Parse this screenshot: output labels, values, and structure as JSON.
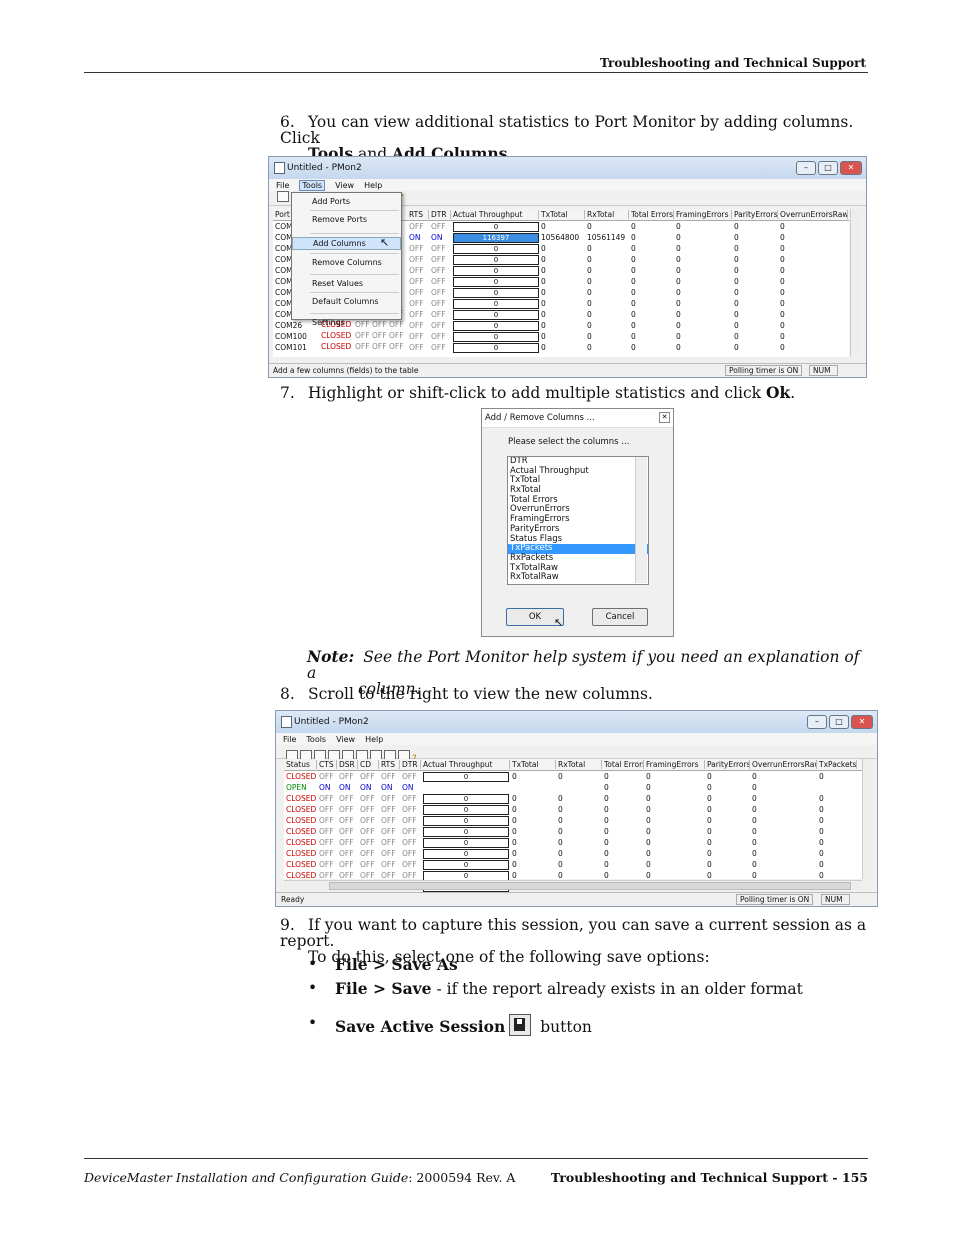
{
  "header": {
    "title": "Troubleshooting and Technical Support"
  },
  "steps": {
    "s6_num": "6.",
    "s6_line1": "You can view additional statistics to Port Monitor by adding columns. Click",
    "s6_tools": "Tools",
    "s6_and": " and ",
    "s6_addcols": "Add Columns",
    "s6_end": ".",
    "s7_num": "7.",
    "s7_text": "Highlight or shift-click to add multiple statistics and click ",
    "s7_ok": "Ok",
    "s7_end": ".",
    "note_label": "Note:",
    "note_line1": "See the Port Monitor help system if you need an explanation of a",
    "note_line2": "column.",
    "s8_num": "8.",
    "s8_text": "Scroll to the right to view the new columns.",
    "s9_num": "9.",
    "s9_line1": "If you want to capture this session, you can save a current session as a report.",
    "s9_line2": "To do this, select one of the following save options:",
    "bullet1": "File > Save As",
    "bullet2_bold": "File > Save",
    "bullet2_rest": " - if the report already exists in an older format",
    "bullet3_bold": "Save Active Session",
    "bullet3_rest": "button"
  },
  "shot1": {
    "title": "Untitled - PMon2",
    "menu": [
      "File",
      "Tools",
      "View",
      "Help"
    ],
    "popup_items": [
      "Add Ports",
      "Remove Ports",
      "Add Columns",
      "Remove Columns",
      "Reset Values",
      "Default Columns",
      "Settings"
    ],
    "columns": [
      "Port",
      "RTS",
      "DTR",
      "Actual Throughput",
      "TxTotal",
      "RxTotal",
      "Total Errors",
      "FramingErrors",
      "ParityErrors",
      "OverrunErrorsRaw"
    ],
    "rows": [
      {
        "port": "COM",
        "st": "",
        "rts": "OFF",
        "dtr": "OFF",
        "thr": "0",
        "tx": "0",
        "rx": "0",
        "te": "0",
        "fe": "0",
        "pe": "0",
        "oe": "0"
      },
      {
        "port": "COM",
        "st": "",
        "rts": "ON",
        "dtr": "ON",
        "thr": "116397",
        "tx": "10564800",
        "rx": "10561149",
        "te": "0",
        "fe": "0",
        "pe": "0",
        "oe": "0"
      },
      {
        "port": "COM",
        "st": "",
        "rts": "OFF",
        "dtr": "OFF",
        "thr": "0",
        "tx": "0",
        "rx": "0",
        "te": "0",
        "fe": "0",
        "pe": "0",
        "oe": "0"
      },
      {
        "port": "COM",
        "st": "",
        "rts": "OFF",
        "dtr": "OFF",
        "thr": "0",
        "tx": "0",
        "rx": "0",
        "te": "0",
        "fe": "0",
        "pe": "0",
        "oe": "0"
      },
      {
        "port": "COM",
        "st": "",
        "rts": "OFF",
        "dtr": "OFF",
        "thr": "0",
        "tx": "0",
        "rx": "0",
        "te": "0",
        "fe": "0",
        "pe": "0",
        "oe": "0"
      },
      {
        "port": "COM",
        "st": "",
        "rts": "OFF",
        "dtr": "OFF",
        "thr": "0",
        "tx": "0",
        "rx": "0",
        "te": "0",
        "fe": "0",
        "pe": "0",
        "oe": "0"
      },
      {
        "port": "COM",
        "st": "",
        "rts": "OFF",
        "dtr": "OFF",
        "thr": "0",
        "tx": "0",
        "rx": "0",
        "te": "0",
        "fe": "0",
        "pe": "0",
        "oe": "0"
      },
      {
        "port": "COM",
        "st": "",
        "rts": "OFF",
        "dtr": "OFF",
        "thr": "0",
        "tx": "0",
        "rx": "0",
        "te": "0",
        "fe": "0",
        "pe": "0",
        "oe": "0"
      },
      {
        "port": "COM25",
        "st": "CLOSED",
        "rts": "OFF",
        "dtr": "OFF",
        "thr": "0",
        "tx": "0",
        "rx": "0",
        "te": "0",
        "fe": "0",
        "pe": "0",
        "oe": "0"
      },
      {
        "port": "COM26",
        "st": "CLOSED",
        "rts": "OFF",
        "dtr": "OFF",
        "thr": "0",
        "tx": "0",
        "rx": "0",
        "te": "0",
        "fe": "0",
        "pe": "0",
        "oe": "0"
      },
      {
        "port": "COM100",
        "st": "CLOSED",
        "rts": "OFF",
        "dtr": "OFF",
        "thr": "0",
        "tx": "0",
        "rx": "0",
        "te": "0",
        "fe": "0",
        "pe": "0",
        "oe": "0"
      },
      {
        "port": "COM101",
        "st": "CLOSED",
        "rts": "OFF",
        "dtr": "OFF",
        "thr": "0",
        "tx": "0",
        "rx": "0",
        "te": "0",
        "fe": "0",
        "pe": "0",
        "oe": "0"
      }
    ],
    "mid_flags": "OFF",
    "status_left": "Add a few columns (fields) to the table",
    "status_timer": "Polling timer is ON",
    "status_num": "NUM"
  },
  "dialog": {
    "title": "Add / Remove Columns ...",
    "prompt": "Please select the columns ...",
    "items": [
      "DTR",
      "Actual Throughput",
      "TxTotal",
      "RxTotal",
      "Total Errors",
      "OverrunErrors",
      "FramingErrors",
      "ParityErrors",
      "Status Flags",
      "TxPackets",
      "RxPackets",
      "TxTotalRaw",
      "RxTotalRaw"
    ],
    "selected": "TxPackets",
    "ok": "OK",
    "cancel": "Cancel"
  },
  "shot2": {
    "title": "Untitled - PMon2",
    "menu": [
      "File",
      "Tools",
      "View",
      "Help"
    ],
    "columns": [
      "Status",
      "CTS",
      "DSR",
      "CD",
      "RTS",
      "DTR",
      "Actual Throughput",
      "TxTotal",
      "RxTotal",
      "Total Errors",
      "FramingErrors",
      "ParityErrors",
      "OverrunErrorsRaw",
      "TxPackets"
    ],
    "rows": [
      {
        "st": "CLOSED",
        "f": [
          "OFF",
          "OFF",
          "OFF",
          "OFF",
          "OFF"
        ],
        "thr": "0",
        "tx": "0",
        "rx": "0",
        "te": "0",
        "fe": "0",
        "pe": "0",
        "oe": "0",
        "tp": "0"
      },
      {
        "st": "OPEN",
        "f": [
          "ON",
          "ON",
          "ON",
          "ON",
          "ON"
        ],
        "thr": "",
        "tx": "",
        "rx": "",
        "te": "0",
        "fe": "0",
        "pe": "0",
        "oe": "0",
        "tp": ""
      },
      {
        "st": "CLOSED",
        "f": [
          "OFF",
          "OFF",
          "OFF",
          "OFF",
          "OFF"
        ],
        "thr": "0",
        "tx": "0",
        "rx": "0",
        "te": "0",
        "fe": "0",
        "pe": "0",
        "oe": "0",
        "tp": "0"
      },
      {
        "st": "CLOSED",
        "f": [
          "OFF",
          "OFF",
          "OFF",
          "OFF",
          "OFF"
        ],
        "thr": "0",
        "tx": "0",
        "rx": "0",
        "te": "0",
        "fe": "0",
        "pe": "0",
        "oe": "0",
        "tp": "0"
      },
      {
        "st": "CLOSED",
        "f": [
          "OFF",
          "OFF",
          "OFF",
          "OFF",
          "OFF"
        ],
        "thr": "0",
        "tx": "0",
        "rx": "0",
        "te": "0",
        "fe": "0",
        "pe": "0",
        "oe": "0",
        "tp": "0"
      },
      {
        "st": "CLOSED",
        "f": [
          "OFF",
          "OFF",
          "OFF",
          "OFF",
          "OFF"
        ],
        "thr": "0",
        "tx": "0",
        "rx": "0",
        "te": "0",
        "fe": "0",
        "pe": "0",
        "oe": "0",
        "tp": "0"
      },
      {
        "st": "CLOSED",
        "f": [
          "OFF",
          "OFF",
          "OFF",
          "OFF",
          "OFF"
        ],
        "thr": "0",
        "tx": "0",
        "rx": "0",
        "te": "0",
        "fe": "0",
        "pe": "0",
        "oe": "0",
        "tp": "0"
      },
      {
        "st": "CLOSED",
        "f": [
          "OFF",
          "OFF",
          "OFF",
          "OFF",
          "OFF"
        ],
        "thr": "0",
        "tx": "0",
        "rx": "0",
        "te": "0",
        "fe": "0",
        "pe": "0",
        "oe": "0",
        "tp": "0"
      },
      {
        "st": "CLOSED",
        "f": [
          "OFF",
          "OFF",
          "OFF",
          "OFF",
          "OFF"
        ],
        "thr": "0",
        "tx": "0",
        "rx": "0",
        "te": "0",
        "fe": "0",
        "pe": "0",
        "oe": "0",
        "tp": "0"
      },
      {
        "st": "CLOSED",
        "f": [
          "OFF",
          "OFF",
          "OFF",
          "OFF",
          "OFF"
        ],
        "thr": "0",
        "tx": "0",
        "rx": "0",
        "te": "0",
        "fe": "0",
        "pe": "0",
        "oe": "0",
        "tp": "0"
      },
      {
        "st": "CLOSED",
        "f": [
          "OFF",
          "OFF",
          "OFF",
          "OFF",
          "OFF"
        ],
        "thr": "0",
        "tx": "0",
        "rx": "0",
        "te": "0",
        "fe": "0",
        "pe": "0",
        "oe": "0",
        "tp": "0"
      }
    ],
    "status_left": "Ready",
    "status_timer": "Polling timer is ON",
    "status_num": "NUM"
  },
  "footer": {
    "left_italic": "DeviceMaster Installation and Configuration Guide",
    "left_rest": ": 2000594 Rev. A",
    "right": "Troubleshooting and Technical Support  - 155"
  }
}
